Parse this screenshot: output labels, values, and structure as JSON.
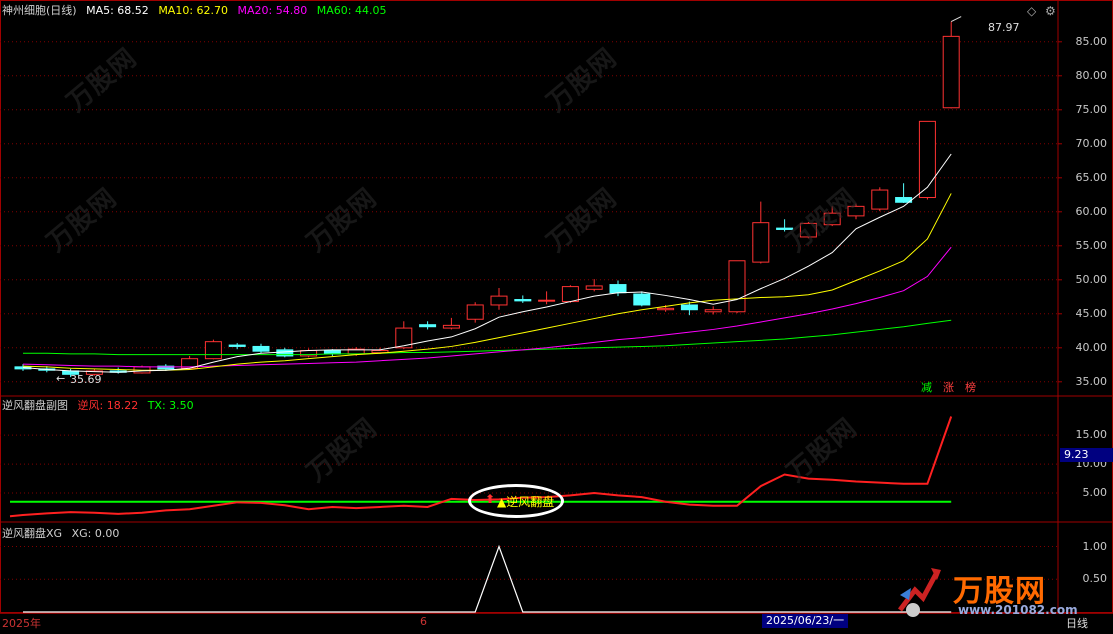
{
  "main_header": {
    "title": "神州细胞(日线)",
    "ma5": "MA5: 68.52",
    "ma10": "MA10: 62.70",
    "ma20": "MA20: 54.80",
    "ma60": "MA60: 44.05"
  },
  "sub1_header": {
    "title": "逆风翻盘副图",
    "nf": "逆风: 18.22",
    "tx": "TX: 3.50",
    "current_value": "9.23",
    "signal_label": "逆风翻盘"
  },
  "sub2_header": {
    "title": "逆风翻盘XG",
    "xg": "XG: 0.00"
  },
  "price_axis": [
    "85.00",
    "80.00",
    "75.00",
    "70.00",
    "65.00",
    "60.00",
    "55.00",
    "50.00",
    "45.00",
    "40.00",
    "35.00"
  ],
  "sub1_axis": [
    "15.00",
    "10.00",
    "5.00"
  ],
  "sub2_axis": [
    "1.00",
    "0.50"
  ],
  "annotations": {
    "high": "87.97",
    "low": "35.69"
  },
  "tags": [
    "减",
    "涨",
    "榜"
  ],
  "dates": {
    "start": "2025年",
    "mid": "6",
    "cursor": "2025/06/23/一",
    "period": "日线"
  },
  "watermark": {
    "logo": "万股网",
    "url": "www.201082.com"
  },
  "colors": {
    "up": "#ff3232",
    "down": "#54ffff",
    "ma5": "#ffffff",
    "ma10": "#ffff00",
    "ma20": "#ff00ff",
    "ma60": "#00ff00",
    "grid": "#800000"
  },
  "chart_data": {
    "type": "candlestick",
    "candles": [
      {
        "o": 37.2,
        "h": 37.6,
        "l": 36.6,
        "c": 36.9
      },
      {
        "o": 36.9,
        "h": 37.3,
        "l": 36.4,
        "c": 36.7
      },
      {
        "o": 36.6,
        "h": 36.9,
        "l": 35.69,
        "c": 36.1
      },
      {
        "o": 36.1,
        "h": 36.9,
        "l": 35.9,
        "c": 36.6
      },
      {
        "o": 36.6,
        "h": 37.1,
        "l": 36.2,
        "c": 36.4
      },
      {
        "o": 36.3,
        "h": 37.4,
        "l": 36.2,
        "c": 37.2
      },
      {
        "o": 37.3,
        "h": 37.6,
        "l": 36.6,
        "c": 36.9
      },
      {
        "o": 37.0,
        "h": 38.8,
        "l": 36.9,
        "c": 38.4
      },
      {
        "o": 38.4,
        "h": 41.2,
        "l": 38.3,
        "c": 40.9
      },
      {
        "o": 40.4,
        "h": 40.7,
        "l": 39.8,
        "c": 40.2
      },
      {
        "o": 40.2,
        "h": 40.6,
        "l": 39.2,
        "c": 39.5
      },
      {
        "o": 39.7,
        "h": 40.0,
        "l": 38.6,
        "c": 38.8
      },
      {
        "o": 38.8,
        "h": 39.9,
        "l": 38.6,
        "c": 39.6
      },
      {
        "o": 39.6,
        "h": 39.8,
        "l": 38.8,
        "c": 39.1
      },
      {
        "o": 39.1,
        "h": 40.1,
        "l": 38.8,
        "c": 39.8
      },
      {
        "o": 39.3,
        "h": 40.0,
        "l": 39.1,
        "c": 39.6
      },
      {
        "o": 40.0,
        "h": 43.9,
        "l": 39.8,
        "c": 42.9
      },
      {
        "o": 43.4,
        "h": 43.9,
        "l": 42.7,
        "c": 43.1
      },
      {
        "o": 42.9,
        "h": 44.4,
        "l": 42.7,
        "c": 43.3
      },
      {
        "o": 44.2,
        "h": 46.7,
        "l": 43.7,
        "c": 46.3
      },
      {
        "o": 46.3,
        "h": 48.8,
        "l": 45.6,
        "c": 47.6
      },
      {
        "o": 47.1,
        "h": 47.7,
        "l": 46.6,
        "c": 46.9
      },
      {
        "o": 46.9,
        "h": 48.3,
        "l": 46.4,
        "c": 47.0
      },
      {
        "o": 46.8,
        "h": 49.2,
        "l": 46.6,
        "c": 49.0
      },
      {
        "o": 48.6,
        "h": 50.1,
        "l": 48.3,
        "c": 49.1
      },
      {
        "o": 49.3,
        "h": 49.9,
        "l": 47.6,
        "c": 48.1
      },
      {
        "o": 47.9,
        "h": 48.3,
        "l": 46.1,
        "c": 46.3
      },
      {
        "o": 45.6,
        "h": 46.3,
        "l": 45.3,
        "c": 45.8
      },
      {
        "o": 46.3,
        "h": 46.8,
        "l": 44.8,
        "c": 45.6
      },
      {
        "o": 45.3,
        "h": 46.1,
        "l": 44.9,
        "c": 45.6
      },
      {
        "o": 45.3,
        "h": 52.7,
        "l": 45.1,
        "c": 52.8
      },
      {
        "o": 52.6,
        "h": 61.5,
        "l": 52.4,
        "c": 58.4
      },
      {
        "o": 57.6,
        "h": 58.9,
        "l": 57.1,
        "c": 57.4
      },
      {
        "o": 56.3,
        "h": 58.5,
        "l": 56.1,
        "c": 58.3
      },
      {
        "o": 58.1,
        "h": 60.8,
        "l": 57.9,
        "c": 59.8
      },
      {
        "o": 59.4,
        "h": 61.2,
        "l": 58.9,
        "c": 60.8
      },
      {
        "o": 60.4,
        "h": 63.6,
        "l": 60.1,
        "c": 63.2
      },
      {
        "o": 62.1,
        "h": 64.2,
        "l": 61.3,
        "c": 61.4
      },
      {
        "o": 62.1,
        "h": 73.3,
        "l": 61.8,
        "c": 73.3
      },
      {
        "o": 75.3,
        "h": 87.97,
        "l": 75.2,
        "c": 85.8
      }
    ],
    "ma5": [
      37.1,
      36.8,
      36.6,
      36.5,
      36.4,
      36.6,
      36.7,
      37.0,
      37.9,
      38.7,
      39.2,
      39.4,
      39.6,
      39.7,
      39.7,
      39.7,
      40.3,
      41.0,
      41.6,
      42.8,
      44.5,
      45.3,
      46.0,
      46.8,
      47.6,
      48.1,
      48.2,
      47.7,
      47.1,
      46.4,
      47.1,
      48.7,
      50.2,
      52.0,
      54.0,
      57.5,
      59.2,
      60.8,
      63.6,
      68.5
    ],
    "ma10": [
      37.3,
      37.2,
      37.0,
      36.9,
      36.8,
      36.7,
      36.7,
      36.8,
      37.2,
      37.6,
      37.9,
      38.1,
      38.4,
      38.7,
      39.0,
      39.2,
      39.5,
      39.8,
      40.2,
      40.8,
      41.5,
      42.2,
      42.9,
      43.6,
      44.3,
      45.0,
      45.6,
      46.1,
      46.6,
      47.0,
      47.2,
      47.4,
      47.5,
      47.8,
      48.5,
      49.9,
      51.3,
      52.8,
      56.0,
      62.7
    ],
    "ma20": [
      37.6,
      37.5,
      37.4,
      37.3,
      37.3,
      37.2,
      37.2,
      37.2,
      37.3,
      37.4,
      37.5,
      37.6,
      37.7,
      37.8,
      37.9,
      38.1,
      38.3,
      38.5,
      38.8,
      39.1,
      39.4,
      39.7,
      40.0,
      40.4,
      40.8,
      41.2,
      41.5,
      41.9,
      42.3,
      42.7,
      43.2,
      43.8,
      44.4,
      45.0,
      45.7,
      46.5,
      47.4,
      48.4,
      50.5,
      54.8
    ],
    "ma60": [
      39.2,
      39.2,
      39.1,
      39.1,
      39.0,
      39.0,
      39.0,
      39.0,
      39.0,
      39.0,
      39.0,
      39.0,
      39.0,
      39.1,
      39.1,
      39.2,
      39.3,
      39.3,
      39.4,
      39.5,
      39.6,
      39.7,
      39.8,
      39.9,
      40.0,
      40.1,
      40.2,
      40.3,
      40.5,
      40.7,
      40.9,
      41.1,
      41.3,
      41.6,
      41.9,
      42.3,
      42.7,
      43.1,
      43.6,
      44.05
    ],
    "sub1_nf": [
      1.2,
      1.5,
      1.7,
      1.6,
      1.4,
      1.6,
      2.0,
      2.2,
      2.8,
      3.4,
      3.3,
      2.9,
      2.2,
      2.6,
      2.4,
      2.6,
      2.8,
      2.6,
      4.0,
      3.8,
      3.9,
      4.2,
      4.3,
      4.6,
      5.0,
      4.6,
      4.3,
      3.5,
      3.0,
      2.8,
      2.8,
      6.2,
      8.2,
      7.5,
      7.3,
      7.0,
      6.8,
      6.6,
      6.6,
      18.22
    ],
    "sub1_tx": 3.5,
    "sub2_xg": [
      0,
      0,
      0,
      0,
      0,
      0,
      0,
      0,
      0,
      0,
      0,
      0,
      0,
      0,
      0,
      0,
      0,
      0,
      0,
      0,
      1,
      0,
      0,
      0,
      0,
      0,
      0,
      0,
      0,
      0,
      0,
      0,
      0,
      0,
      0,
      0,
      0,
      0,
      0,
      0
    ],
    "price_range": [
      33.5,
      88.5
    ],
    "sub1_range": [
      0,
      19
    ],
    "sub2_range": [
      0,
      1.1
    ]
  }
}
